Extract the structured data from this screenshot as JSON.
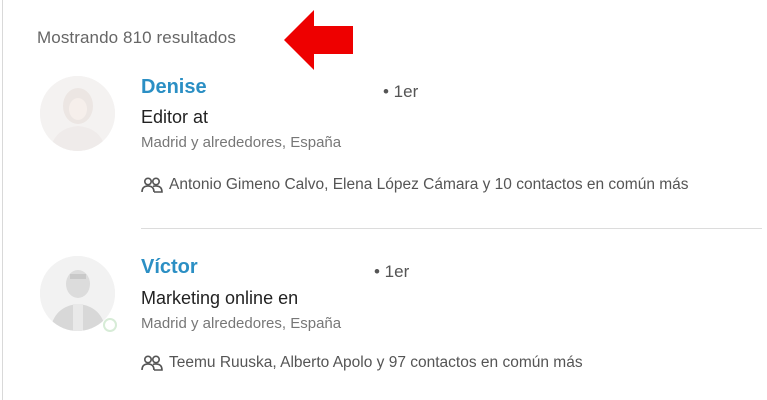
{
  "search": {
    "results_count_text": "Mostrando 810 resultados"
  },
  "annotation": {
    "arrow_color": "#ee0000",
    "arrow_icon": "red-left-arrow-icon"
  },
  "results": [
    {
      "name": "Denise",
      "degree": "• 1er",
      "headline": "Editor at",
      "location": "Madrid y alrededores, España",
      "shared_connections": "Antonio Gimeno Calvo, Elena López Cámara y 10 contactos en común más",
      "shared_icon": "people-icon"
    },
    {
      "name": "Víctor",
      "degree": "• 1er",
      "headline": "Marketing online en",
      "location": "Madrid y alrededores, España",
      "shared_connections": "Teemu Ruuska, Alberto Apolo y 97 contactos en común más",
      "shared_icon": "people-icon"
    }
  ],
  "colors": {
    "name_link": "#2b8fc4",
    "muted_text": "#777777"
  }
}
